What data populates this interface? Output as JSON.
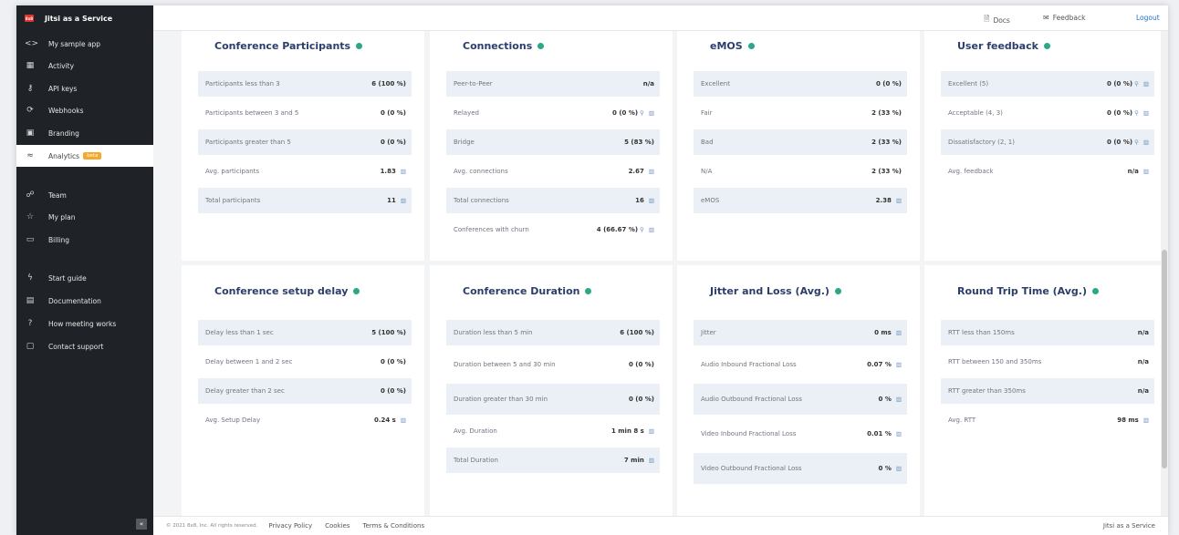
{
  "app": {
    "title": "Jitsi as a Service",
    "logo_text": "8x8"
  },
  "sidebar": {
    "items": [
      {
        "key": "my-sample-app",
        "icon": "<>",
        "label": "My sample app"
      },
      {
        "key": "activity",
        "icon": "▦",
        "label": "Activity"
      },
      {
        "key": "api-keys",
        "icon": "⚷",
        "label": "API keys"
      },
      {
        "key": "webhooks",
        "icon": "⟳",
        "label": "Webhooks"
      },
      {
        "key": "branding",
        "icon": "▣",
        "label": "Branding"
      },
      {
        "key": "analytics",
        "icon": "≈",
        "label": "Analytics",
        "badge": "beta",
        "active": true
      },
      {
        "key": "team",
        "icon": "☍",
        "label": "Team"
      },
      {
        "key": "my-plan",
        "icon": "☆",
        "label": "My plan"
      },
      {
        "key": "billing",
        "icon": "▭",
        "label": "Billing"
      },
      {
        "key": "start-guide",
        "icon": "ϟ",
        "label": "Start guide"
      },
      {
        "key": "documentation",
        "icon": "▤",
        "label": "Documentation"
      },
      {
        "key": "how-meeting-works",
        "icon": "?",
        "label": "How meeting works"
      },
      {
        "key": "contact-support",
        "icon": "▢",
        "label": "Contact support"
      }
    ],
    "collapse_icon": "«"
  },
  "topbar": {
    "docs": "Docs",
    "feedback": "Feedback",
    "logout": "Logout"
  },
  "cards": [
    {
      "title": "Conference Participants",
      "rows": [
        {
          "label": "Participants less than 3",
          "value": "6 (100 %)"
        },
        {
          "label": "Participants between 3 and 5",
          "value": "0 (0 %)"
        },
        {
          "label": "Participants greater than 5",
          "value": "0 (0 %)"
        },
        {
          "label": "Avg. participants",
          "value": "1.83",
          "chart": true
        },
        {
          "label": "Total participants",
          "value": "11",
          "chart": true
        }
      ]
    },
    {
      "title": "Connections",
      "rows": [
        {
          "label": "Peer-to-Peer",
          "value": "n/a"
        },
        {
          "label": "Relayed",
          "value": "0 (0 %)",
          "search": true,
          "chart": true
        },
        {
          "label": "Bridge",
          "value": "5 (83 %)"
        },
        {
          "label": "Avg. connections",
          "value": "2.67",
          "chart": true
        },
        {
          "label": "Total connections",
          "value": "16",
          "chart": true
        },
        {
          "label": "Conferences with churn",
          "value": "4 (66.67 %)",
          "search": true,
          "chart": true
        }
      ]
    },
    {
      "title": "eMOS",
      "rows": [
        {
          "label": "Excellent",
          "value": "0 (0 %)"
        },
        {
          "label": "Fair",
          "value": "2 (33 %)"
        },
        {
          "label": "Bad",
          "value": "2 (33 %)"
        },
        {
          "label": "N/A",
          "value": "2 (33 %)"
        },
        {
          "label": "eMOS",
          "value": "2.38",
          "chart": true
        }
      ]
    },
    {
      "title": "User feedback",
      "rows": [
        {
          "label": "Excellent (5)",
          "value": "0 (0 %)",
          "search": true,
          "chart": true
        },
        {
          "label": "Acceptable (4, 3)",
          "value": "0 (0 %)",
          "search": true,
          "chart": true
        },
        {
          "label": "Dissatisfactory (2, 1)",
          "value": "0 (0 %)",
          "search": true,
          "chart": true
        },
        {
          "label": "Avg. feedback",
          "value": "n/a",
          "chart": true
        }
      ]
    },
    {
      "title": "Conference setup delay",
      "rows": [
        {
          "label": "Delay less than 1 sec",
          "value": "5 (100 %)"
        },
        {
          "label": "Delay between 1 and 2 sec",
          "value": "0 (0 %)"
        },
        {
          "label": "Delay greater than 2 sec",
          "value": "0 (0 %)"
        },
        {
          "label": "Avg. Setup Delay",
          "value": "0.24 s",
          "chart": true
        }
      ]
    },
    {
      "title": "Conference Duration",
      "rows": [
        {
          "label": "Duration less than 5 min",
          "value": "6 (100 %)"
        },
        {
          "label": "Duration between 5 and 30 min",
          "value": "0 (0 %)"
        },
        {
          "label": "Duration greater than 30 min",
          "value": "0 (0 %)"
        },
        {
          "label": "Avg. Duration",
          "value": "1 min 8 s",
          "chart": true
        },
        {
          "label": "Total Duration",
          "value": "7 min",
          "chart": true
        }
      ]
    },
    {
      "title": "Jitter and Loss (Avg.)",
      "rows": [
        {
          "label": "Jitter",
          "value": "0 ms",
          "chart": true
        },
        {
          "label": "Audio Inbound Fractional Loss",
          "value": "0.07 %",
          "chart": true
        },
        {
          "label": "Audio Outbound Fractional Loss",
          "value": "0 %",
          "chart": true
        },
        {
          "label": "Video Inbound Fractional Loss",
          "value": "0.01 %",
          "chart": true
        },
        {
          "label": "Video Outbound Fractional Loss",
          "value": "0 %",
          "chart": true
        }
      ]
    },
    {
      "title": "Round Trip Time (Avg.)",
      "rows": [
        {
          "label": "RTT less than 150ms",
          "value": "n/a"
        },
        {
          "label": "RTT between 150 and 350ms",
          "value": "n/a"
        },
        {
          "label": "RTT greater than 350ms",
          "value": "n/a"
        },
        {
          "label": "Avg. RTT",
          "value": "98 ms",
          "chart": true
        }
      ]
    }
  ],
  "footer": {
    "copyright": "© 2021 8x8, Inc. All rights reserved.",
    "links": [
      "Privacy Policy",
      "Cookies",
      "Terms & Conditions"
    ],
    "brand": "Jitsi as a Service"
  }
}
